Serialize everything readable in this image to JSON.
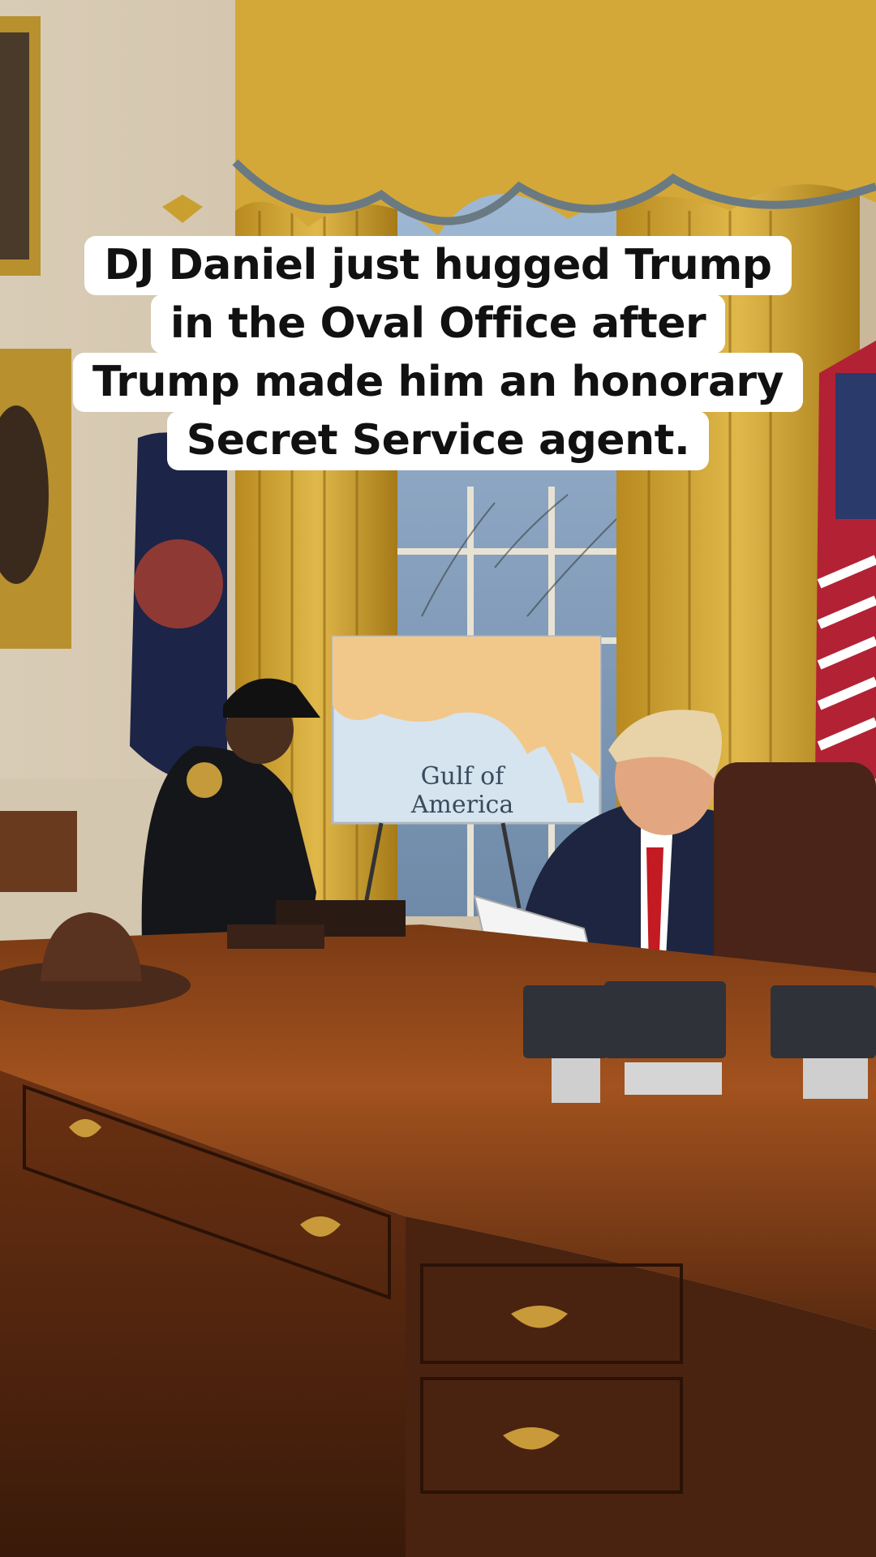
{
  "caption": {
    "lines": [
      "DJ Daniel just hugged Trump",
      "in the Oval Office after",
      "Trump made him an honorary",
      "Secret Service agent."
    ]
  },
  "map_sign": {
    "label": "Gulf of America"
  }
}
